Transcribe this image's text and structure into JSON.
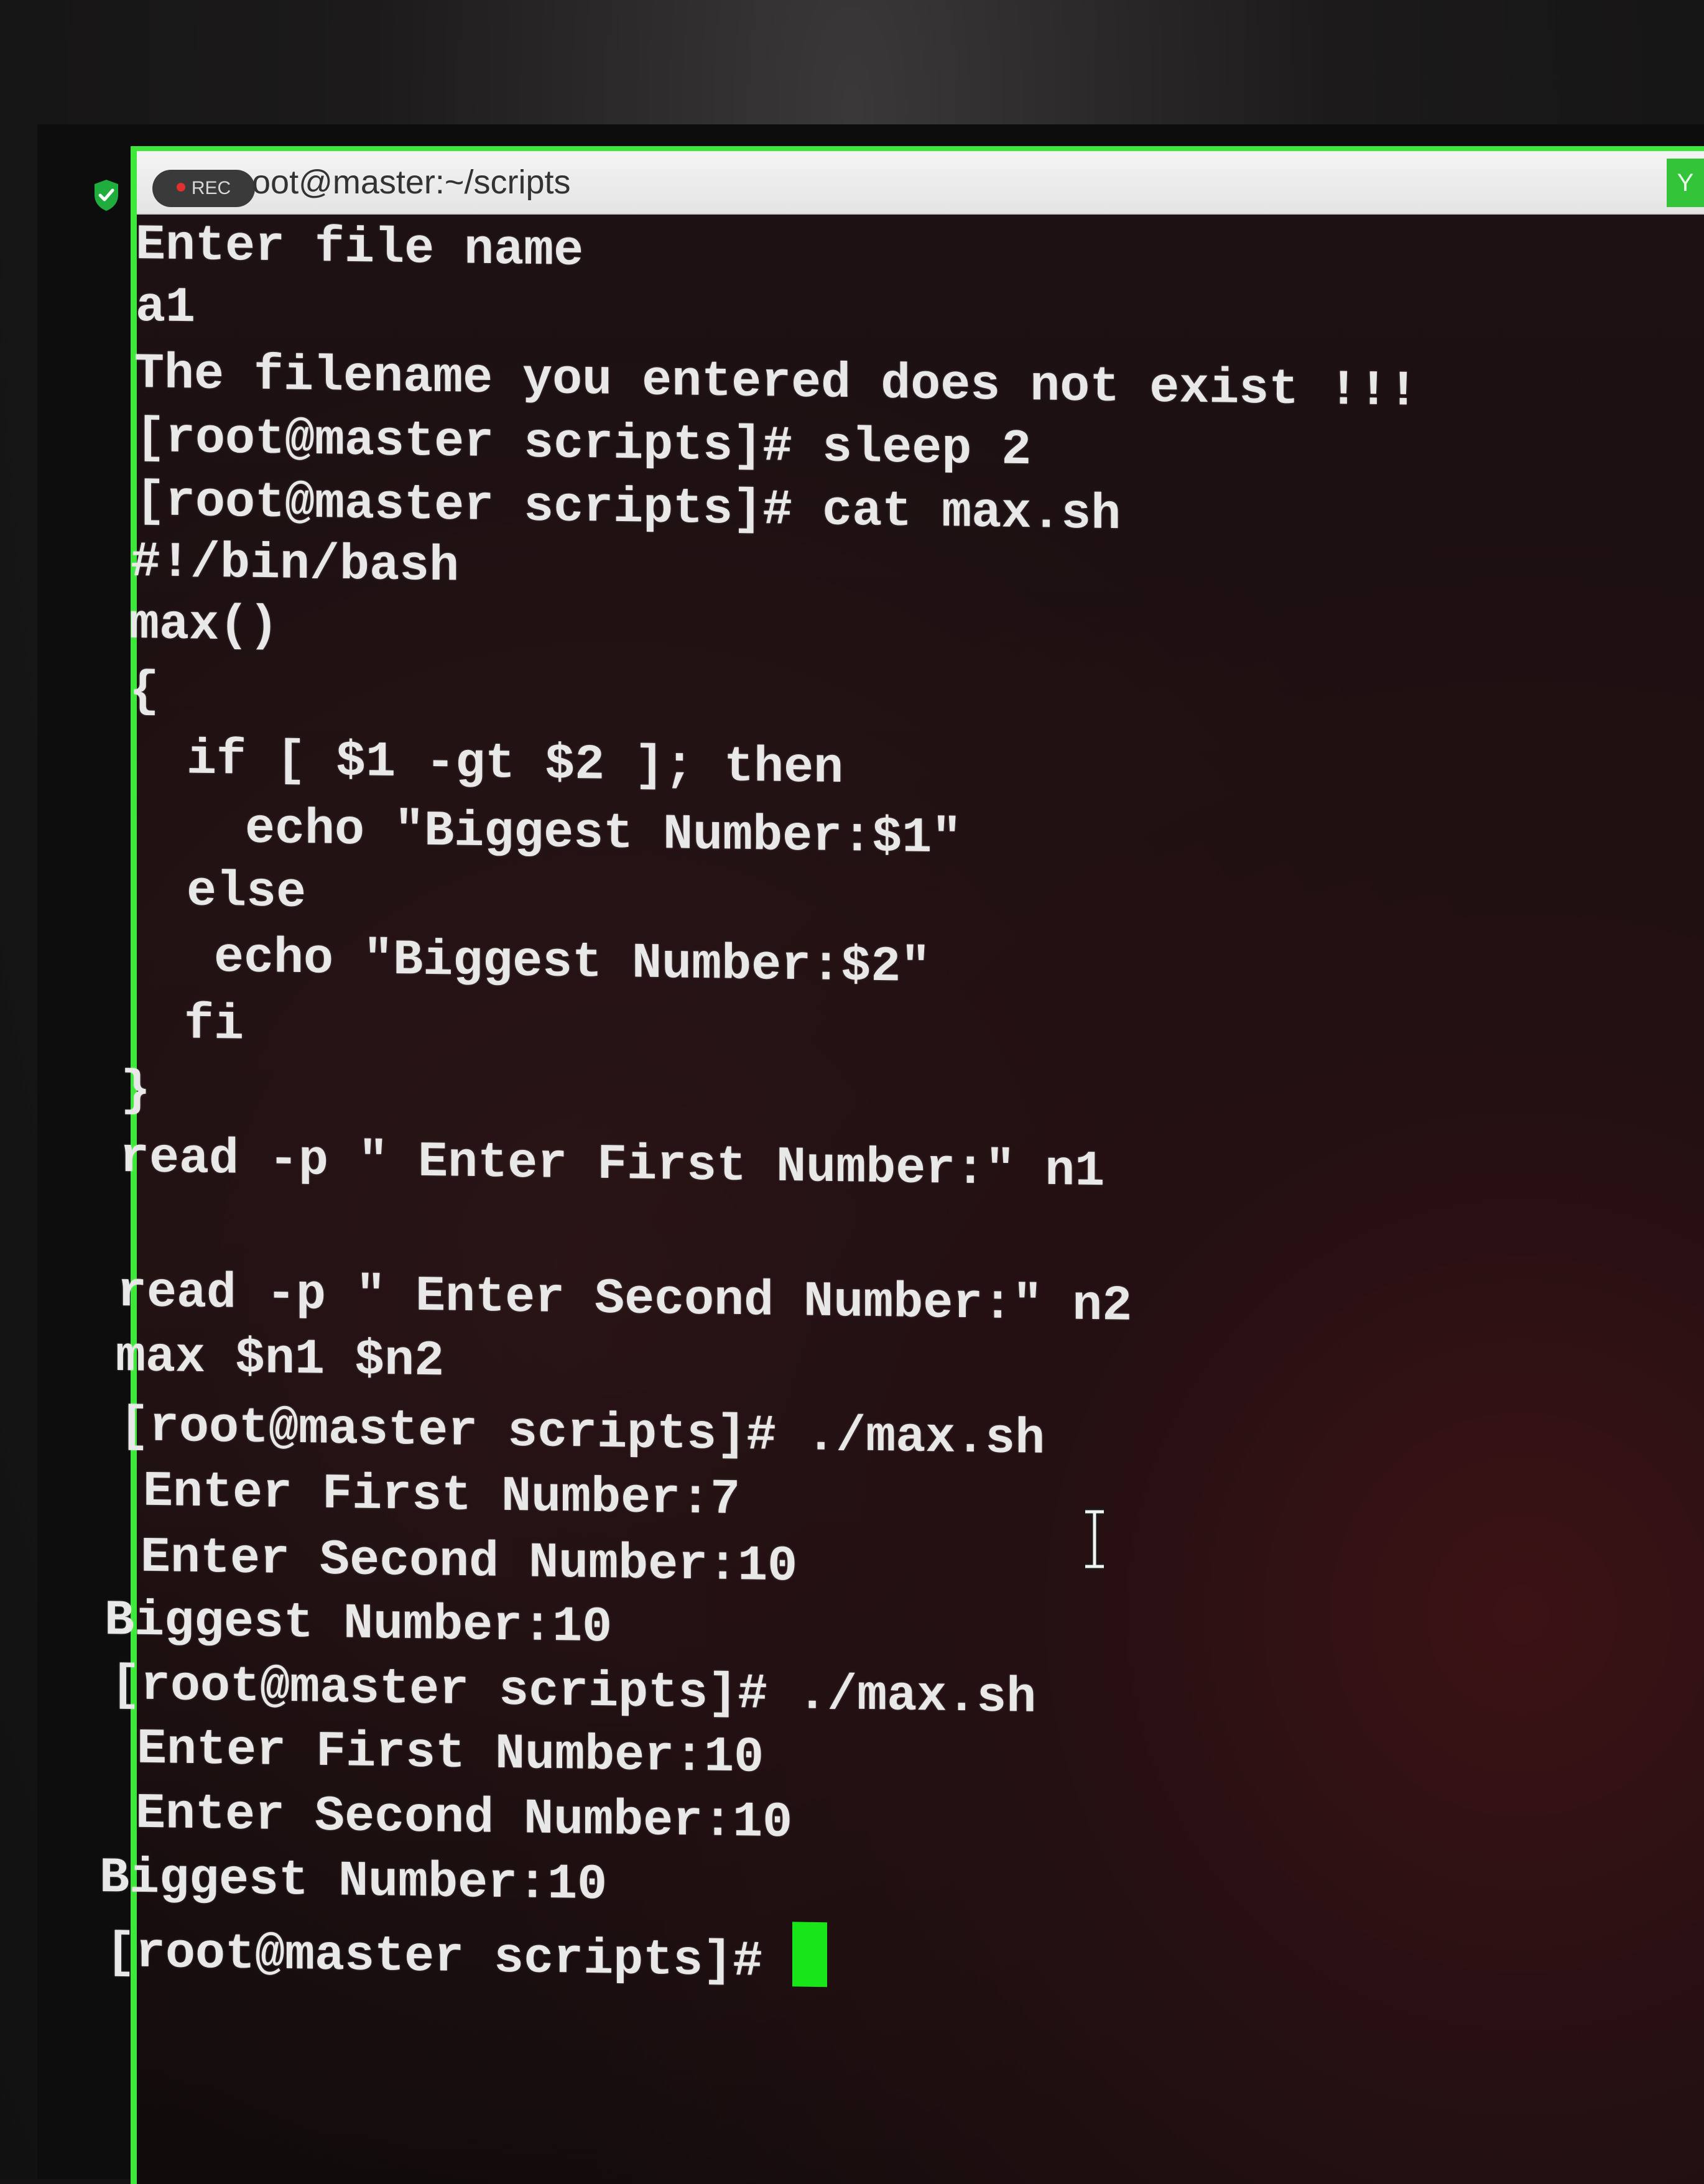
{
  "window": {
    "title": "oot@master:~/scripts",
    "rec_label": "REC",
    "corner_label": "Y"
  },
  "colors": {
    "window_border": "#3ee83a",
    "cursor": "#19e619",
    "terminal_text": "#e8e8e8",
    "terminal_bg": "#1a0f10"
  },
  "icons": [
    "shield-icon",
    "rec-dot-icon",
    "ibeam-cursor-icon"
  ],
  "terminal": {
    "lines": [
      "Enter file name",
      "a1",
      "The filename you entered does not exist !!!",
      "[root@master scripts]# sleep 2",
      "[root@master scripts]# cat max.sh",
      "#!/bin/bash",
      "max()",
      "{",
      "  if [ $1 -gt $2 ]; then",
      "    echo \"Biggest Number:$1\"",
      "  else",
      "   echo \"Biggest Number:$2\"",
      "  fi",
      "}",
      "read -p \" Enter First Number:\" n1",
      "",
      "read -p \" Enter Second Number:\" n2",
      "max $n1 $n2",
      "[root@master scripts]# ./max.sh",
      " Enter First Number:7",
      " Enter Second Number:10",
      "Biggest Number:10",
      "[root@master scripts]# ./max.sh",
      " Enter First Number:10",
      " Enter Second Number:10",
      "Biggest Number:10"
    ],
    "prompt": "[root@master scripts]# "
  }
}
